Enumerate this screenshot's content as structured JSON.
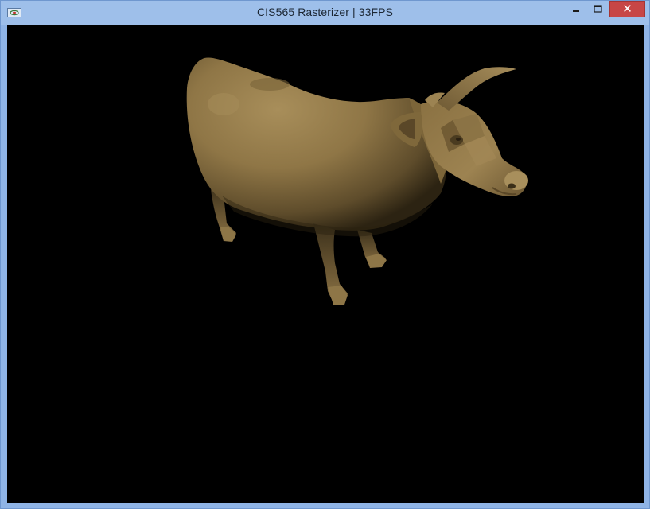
{
  "window": {
    "title": "CIS565 Rasterizer | 33FPS",
    "close_glyph": "✕",
    "icons": [
      "app-icon",
      "minimize-icon",
      "maximize-icon",
      "close-icon"
    ]
  },
  "scene": {
    "background": "#000000",
    "model": "cow",
    "model_color": "#9c8250",
    "frame_color": "#9ebfea"
  }
}
